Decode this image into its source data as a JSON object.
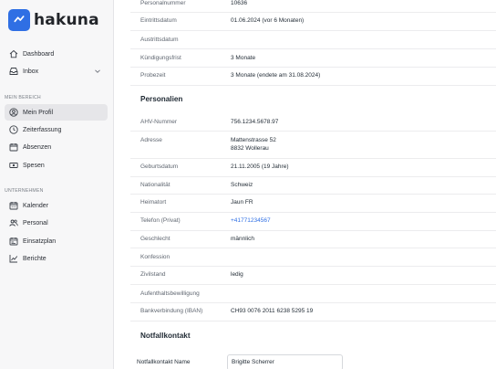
{
  "app": {
    "logo_text": "hakuna",
    "brand_color": "#2f6fe4"
  },
  "sidebar": {
    "top_items": [
      {
        "label": "Dashboard",
        "icon": "home-icon"
      },
      {
        "label": "Inbox",
        "icon": "inbox-icon"
      }
    ],
    "section_mein_bereich": "MEIN BEREICH",
    "mein_bereich_items": [
      {
        "label": "Mein Profil",
        "icon": "user-circle-icon",
        "active": true
      },
      {
        "label": "Zeiterfassung",
        "icon": "clock-icon"
      },
      {
        "label": "Absenzen",
        "icon": "calendar-icon"
      },
      {
        "label": "Spesen",
        "icon": "money-icon"
      }
    ],
    "section_unternehmen": "UNTERNEHMEN",
    "unternehmen_items": [
      {
        "label": "Kalender",
        "icon": "calendar-grid-icon"
      },
      {
        "label": "Personal",
        "icon": "people-icon"
      },
      {
        "label": "Einsatzplan",
        "icon": "schedule-icon"
      },
      {
        "label": "Berichte",
        "icon": "chart-icon"
      }
    ]
  },
  "employment": {
    "rows": [
      {
        "label": "Personalnummer",
        "value": "10636"
      },
      {
        "label": "Eintrittsdatum",
        "value": "01.06.2024 (vor 6 Monaten)"
      },
      {
        "label": "Austrittsdatum",
        "value": ""
      },
      {
        "label": "Kündigungsfrist",
        "value": "3 Monate"
      },
      {
        "label": "Probezeit",
        "value": "3 Monate (endete am 31.08.2024)"
      }
    ]
  },
  "personal": {
    "heading": "Personalien",
    "ahv_label": "AHV-Nummer",
    "ahv_value": "756.1234.5678.97",
    "adresse_label": "Adresse",
    "adresse_line1": "Mattenstrasse 52",
    "adresse_line2": "8832 Wollerau",
    "geburtsdatum_label": "Geburtsdatum",
    "geburtsdatum_value": "21.11.2005 (19 Jahre)",
    "nationalitaet_label": "Nationalität",
    "nationalitaet_value": "Schweiz",
    "heimatort_label": "Heimatort",
    "heimatort_value": "Jaun FR",
    "telefon_label": "Telefon (Privat)",
    "telefon_value": "+41771234567",
    "geschlecht_label": "Geschlecht",
    "geschlecht_value": "männlich",
    "konfession_label": "Konfession",
    "konfession_value": "",
    "zivilstand_label": "Zivilstand",
    "zivilstand_value": "ledig",
    "aufenthalt_label": "Aufenthaltsbewilligung",
    "aufenthalt_value": "",
    "bank_label": "Bankverbindung (IBAN)",
    "bank_value": "CH93 0076 2011 6238 5295 19"
  },
  "emergency": {
    "heading": "Notfallkontakt",
    "name_label": "Notfallkontakt Name",
    "name_value": "Brigitte Scherrer"
  }
}
